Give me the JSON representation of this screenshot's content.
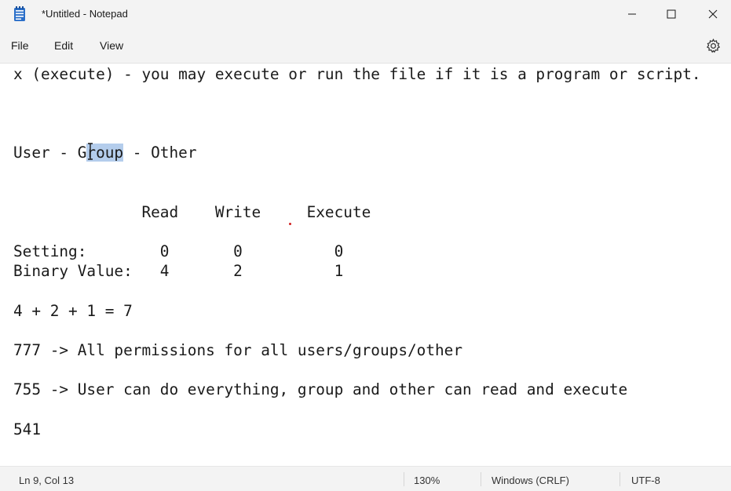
{
  "window": {
    "title": "*Untitled - Notepad"
  },
  "menu": {
    "file": "File",
    "edit": "Edit",
    "view": "View"
  },
  "editor": {
    "lines": {
      "l0": "x (execute) - you may execute or run the file if it is a program or script.",
      "l4_a": "User - G",
      "l4_sel": "roup",
      "l4_b": " - Other",
      "l7": "              Read    Write     Execute",
      "l9": "Setting:        0       0          0",
      "l10": "Binary Value:   4       2          1",
      "l12": "4 + 2 + 1 = 7",
      "l14": "777 -> All permissions for all users/groups/other",
      "l16": "755 -> User can do everything, group and other can read and execute",
      "l18": "541"
    }
  },
  "status": {
    "position": "Ln 9, Col 13",
    "zoom": "130%",
    "line_ending": "Windows (CRLF)",
    "encoding": "UTF-8"
  },
  "colors": {
    "selection": "#b4cdec",
    "chrome": "#f3f3f3",
    "icon_blue": "#2b6fc9"
  }
}
